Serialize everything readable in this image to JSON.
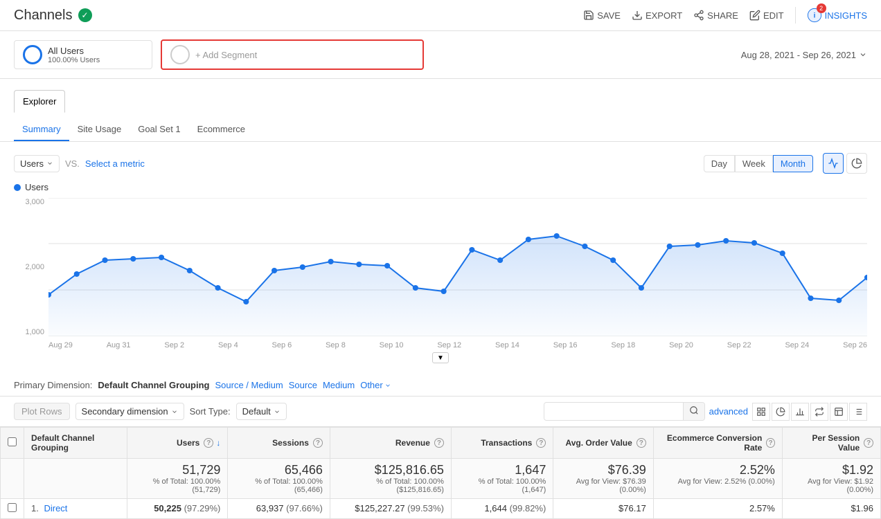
{
  "header": {
    "title": "Channels",
    "verified": true,
    "actions": {
      "save": "SAVE",
      "export": "EXPORT",
      "share": "SHARE",
      "edit": "EDIT",
      "insights": "INSIGHTS",
      "insights_badge": "2"
    }
  },
  "segment": {
    "all_users_label": "All Users",
    "all_users_sub": "100.00% Users",
    "add_segment": "+ Add Segment",
    "date_range": "Aug 28, 2021 - Sep 26, 2021"
  },
  "explorer": {
    "tab_label": "Explorer",
    "sub_tabs": [
      "Summary",
      "Site Usage",
      "Goal Set 1",
      "Ecommerce"
    ],
    "active_sub_tab": 0
  },
  "chart": {
    "metric_label": "Users",
    "vs_label": "VS.",
    "select_metric": "Select a metric",
    "time_buttons": [
      "Day",
      "Week",
      "Month"
    ],
    "active_time": 2,
    "legend_label": "Users",
    "y_axis": [
      "3,000",
      "2,000",
      "1,000"
    ],
    "x_axis": [
      "Aug 29",
      "Aug 31",
      "Sep 2",
      "Sep 4",
      "Sep 6",
      "Sep 8",
      "Sep 10",
      "Sep 12",
      "Sep 14",
      "Sep 16",
      "Sep 18",
      "Sep 20",
      "Sep 22",
      "Sep 24",
      "Sep 26"
    ]
  },
  "table_controls": {
    "primary_dim_label": "Primary Dimension:",
    "primary_dim_active": "Default Channel Grouping",
    "dim_links": [
      "Source / Medium",
      "Source",
      "Medium",
      "Other"
    ],
    "secondary_dim_label": "Secondary dimension",
    "sort_type_label": "Sort Type:",
    "sort_default": "Default",
    "search_placeholder": "",
    "advanced_label": "advanced",
    "plot_rows_label": "Plot Rows"
  },
  "table": {
    "columns": [
      "Default Channel Grouping",
      "Users",
      "Sessions",
      "Revenue",
      "Transactions",
      "Avg. Order Value",
      "Ecommerce Conversion Rate",
      "Per Session Value"
    ],
    "totals": {
      "users": "51,729",
      "users_sub": "% of Total: 100.00% (51,729)",
      "sessions": "65,466",
      "sessions_sub": "% of Total: 100.00% (65,466)",
      "revenue": "$125,816.65",
      "revenue_sub": "% of Total: 100.00% ($125,816.65)",
      "transactions": "1,647",
      "transactions_sub": "% of Total: 100.00% (1,647)",
      "avg_order": "$76.39",
      "avg_order_sub": "Avg for View: $76.39 (0.00%)",
      "conv_rate": "2.52%",
      "conv_rate_sub": "Avg for View: 2.52% (0.00%)",
      "per_session": "$1.92",
      "per_session_sub": "Avg for View: $1.92 (0.00%)"
    },
    "rows": [
      {
        "rank": "1.",
        "name": "Direct",
        "users": "50,225",
        "users_pct": "(97.29%)",
        "sessions": "63,937",
        "sessions_pct": "(97.66%)",
        "revenue": "$125,227.27",
        "revenue_pct": "(99.53%)",
        "transactions": "1,644",
        "transactions_pct": "(99.82%)",
        "avg_order": "$76.17",
        "conv_rate": "2.57%",
        "per_session": "$1.96"
      }
    ]
  }
}
